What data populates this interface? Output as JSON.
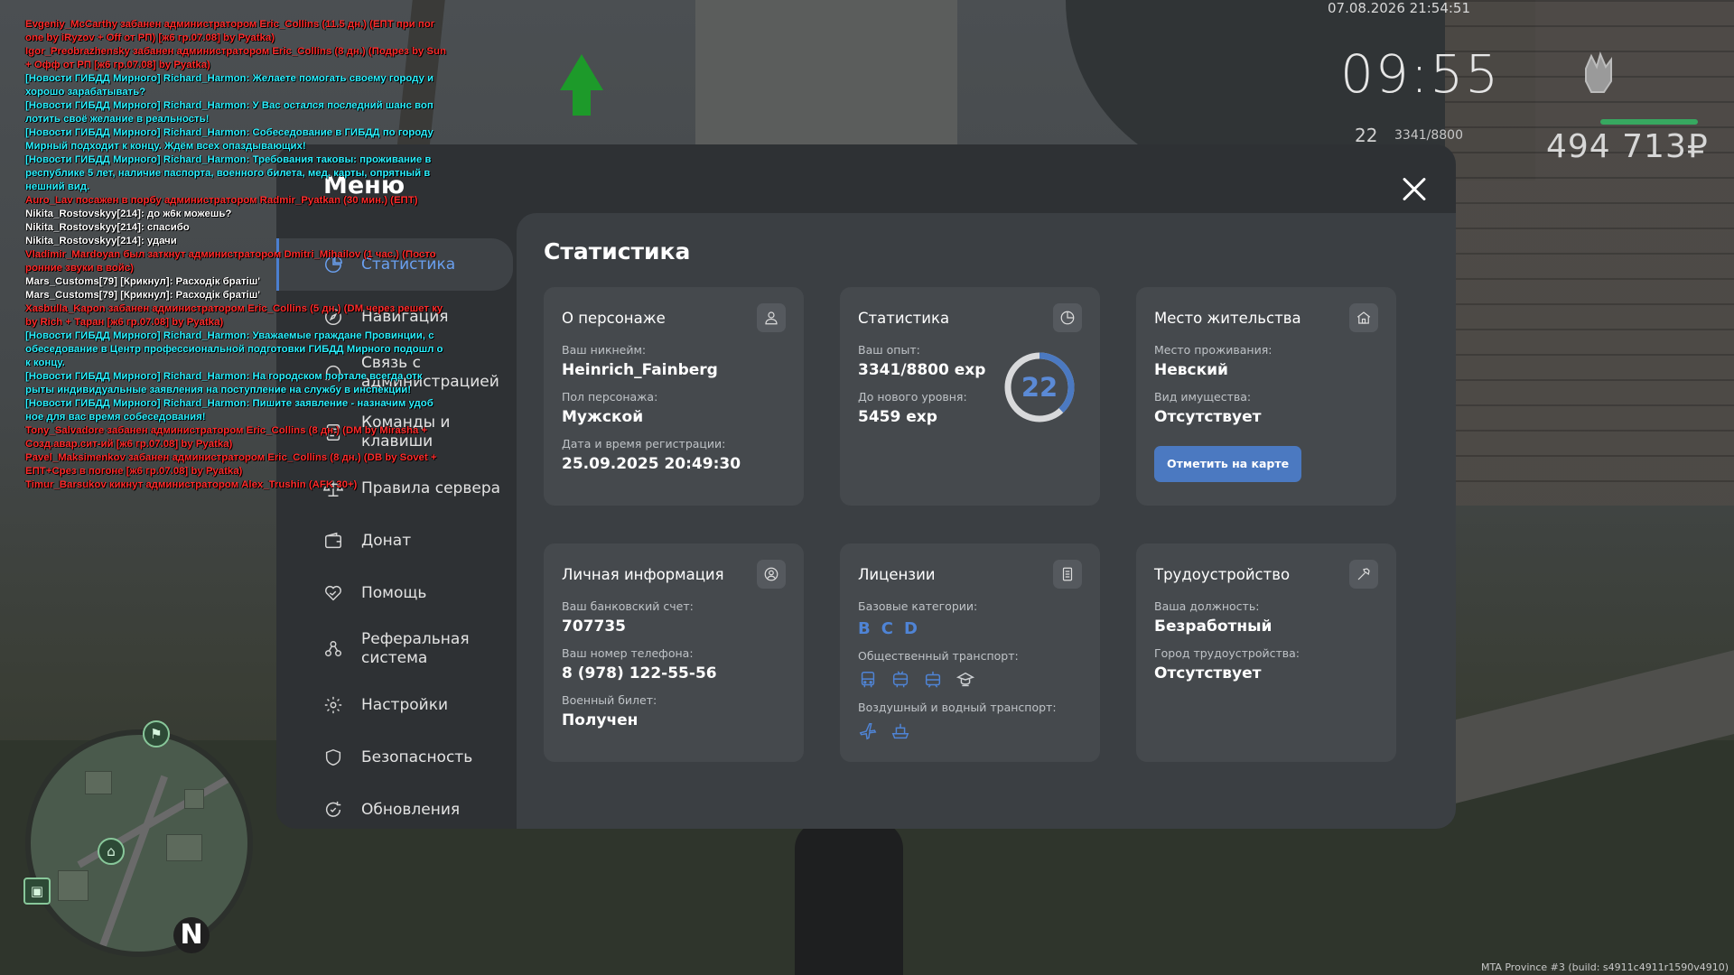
{
  "hud": {
    "datetime": "07.08.2026 21:54:51",
    "clock": "09:55",
    "level": "22",
    "xp": "3341/8800",
    "money": "494 713₽",
    "build": "MTA Province #3 (build: s4911c4911r1590v4910)"
  },
  "chat": [
    {
      "color": "red",
      "text": "Evgeniy_McCarthy забанен администратором Eric_Collins (11.5 дн.) (ЕПТ при пог one by iRyzov + Off от РП) [ж6 гр.07.08] by Pyatka)"
    },
    {
      "color": "red",
      "text": "Igor_Preobrazhensky забанен администратором Eric_Collins (8 дн.) (Подрез by Sun + Офф от РП [ж6 гр.07.08] by Pyatka)"
    },
    {
      "color": "cyan",
      "text": "[Новости ГИБДД Мирного] Richard_Harmon: Желаете помогать своему городу и хорошо зарабатывать?"
    },
    {
      "color": "cyan",
      "text": "[Новости ГИБДД Мирного] Richard_Harmon: У Вас остался последний шанс воп лотить своё желание в реальность!"
    },
    {
      "color": "cyan",
      "text": "[Новости ГИБДД Мирного] Richard_Harmon: Собеседование в ГИБДД по городу Мирный подходит к концу. Ждём всех опаздывающих!"
    },
    {
      "color": "cyan",
      "text": "[Новости ГИБДД Мирного] Richard_Harmon: Требования таковы: проживание в республике 5 лет, наличие паспорта, военного билета, мед. карты, опрятный в нешний вид."
    },
    {
      "color": "red",
      "text": "Auro_Lav посажен в порбу администратором Radmir_Pyatkan (30 мин.) (ЕПТ)"
    },
    {
      "color": "white",
      "text": "Nikita_Rostovskyy[214]: до ж6к можешь?"
    },
    {
      "color": "white",
      "text": "Nikita_Rostovskyy[214]: спасибо"
    },
    {
      "color": "white",
      "text": "Nikita_Rostovskyy[214]: удачи"
    },
    {
      "color": "red",
      "text": "Vladimir_Mardoyan был заткнут администратором Dmitri_Mihailov (1 час.) (Посто ронние звуки в войс)"
    },
    {
      "color": "white",
      "text": "Mars_Customs[79] [Крикнул]: Расходік братіш'"
    },
    {
      "color": "white",
      "text": "Mars_Customs[79] [Крикнул]: Расходік братіш'"
    },
    {
      "color": "red",
      "text": "Xasbulla_Kapon забанен администратором Eric_Collins (5 дн.) (DM через решет ку by Rich + Таран [ж6 гр.07.08] by Pyatka)"
    },
    {
      "color": "cyan",
      "text": "[Новости ГИБДД Мирного] Richard_Harmon: Уважаемые граждане Провинции, с обеседование в Центр профессиональной подготовки ГИБДД Мирного подошл о к концу."
    },
    {
      "color": "cyan",
      "text": "[Новости ГИБДД Мирного] Richard_Harmon: На городском портале всегда отк рыты индивидуальные заявления на поступление на службу в инспекции!"
    },
    {
      "color": "cyan",
      "text": "[Новости ГИБДД Мирного] Richard_Harmon: Пишите заявление - назначим удоб ное для вас время собеседования!"
    },
    {
      "color": "red",
      "text": "Tony_Salvadore забанен администратором Eric_Collins (8 дн.) (DM by Mirasha + Созд.авар.сит-ий [ж6 гр.07.08] by Pyatka)"
    },
    {
      "color": "red",
      "text": "Pavel_Maksimenkov забанен администратором Eric_Collins (8 дн.) (DB by Sovet + ЕПТ+Срез в погоне [ж6 гр.07.08] by Pyatka)"
    },
    {
      "color": "red",
      "text": "Timur_Barsukov кикнут администратором Alex_Trushin (AFK 30+)"
    }
  ],
  "minimap": {
    "north": "N"
  },
  "menu": {
    "title": "Меню",
    "nav": [
      {
        "label": "Статистика",
        "icon": "chart-pie-icon",
        "active": true
      },
      {
        "label": "Навигация",
        "icon": "compass-icon"
      },
      {
        "label": "Связь с администрацией",
        "icon": "headset-icon"
      },
      {
        "label": "Команды и клавиши",
        "icon": "document-icon"
      },
      {
        "label": "Правила сервера",
        "icon": "scales-icon"
      },
      {
        "label": "Донат",
        "icon": "wallet-icon"
      },
      {
        "label": "Помощь",
        "icon": "handshake-icon"
      },
      {
        "label": "Реферальная система",
        "icon": "people-icon"
      },
      {
        "label": "Настройки",
        "icon": "gear-icon"
      },
      {
        "label": "Безопасность",
        "icon": "shield-icon"
      },
      {
        "label": "Обновления",
        "icon": "refresh-icon"
      }
    ]
  },
  "content": {
    "title": "Статистика",
    "character": {
      "title": "О персонаже",
      "nick_label": "Ваш никнейм:",
      "nick": "Heinrich_Fainberg",
      "gender_label": "Пол персонажа:",
      "gender": "Мужской",
      "reg_label": "Дата и время регистрации:",
      "reg": "25.09.2025 20:49:30"
    },
    "stats": {
      "title": "Статистика",
      "exp_label": "Ваш опыт:",
      "exp": "3341/8800 exp",
      "next_label": "До нового уровня:",
      "next": "5459 exp",
      "level": "22",
      "progress": 0.38
    },
    "residence": {
      "title": "Место жительства",
      "place_label": "Место проживания:",
      "place": "Невский",
      "property_label": "Вид имущества:",
      "property": "Отсутствует",
      "map_button": "Отметить на карте"
    },
    "personal": {
      "title": "Личная информация",
      "bank_label": "Ваш банковский счет:",
      "bank": "707735",
      "phone_label": "Ваш номер телефона:",
      "phone": "8 (978) 122-55-56",
      "military_label": "Военный билет:",
      "military": "Получен"
    },
    "licenses": {
      "title": "Лицензии",
      "base_label": "Базовые категории:",
      "base": [
        "B",
        "C",
        "D"
      ],
      "public_label": "Общественный транспорт:",
      "air_label": "Воздушный и водный транспорт:"
    },
    "employment": {
      "title": "Трудоустройство",
      "position_label": "Ваша должность:",
      "position": "Безработный",
      "city_label": "Город трудоустройства:",
      "city": "Отсутствует"
    }
  },
  "colors": {
    "accent": "#4b79c1",
    "active_text": "#6aa0f0",
    "panel": "#2e3134",
    "card": "#45494d"
  }
}
